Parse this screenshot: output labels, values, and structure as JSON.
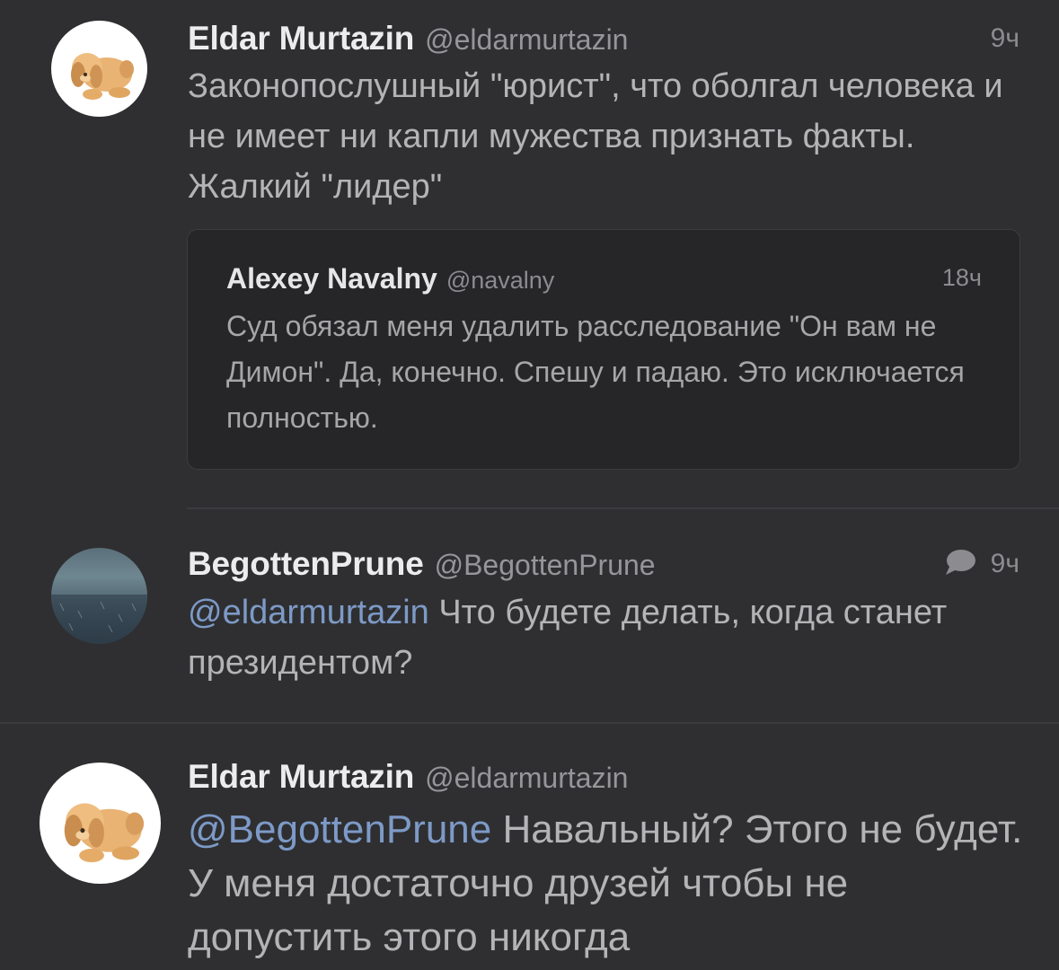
{
  "tweets": [
    {
      "name": "Eldar Murtazin",
      "handle": "@eldarmurtazin",
      "time": "9ч",
      "text": "Законопослушный \"юрист\", что оболгал человека и не имеет ни капли мужества признать факты. Жалкий \"лидер\"",
      "avatar_icon": "plush-dog-avatar",
      "quote": {
        "name": "Alexey Navalny",
        "handle": "@navalny",
        "time": "18ч",
        "text": "Суд обязал меня удалить расследование \"Он вам не Димон\". Да, конечно. Спешу и падаю. Это исключается полностью."
      }
    },
    {
      "name": "BegottenPrune",
      "handle": "@BegottenPrune",
      "time": "9ч",
      "reply_icon": "speech-bubble-icon",
      "mention": "@eldarmurtazin",
      "text": " Что будете делать, когда станет президентом?",
      "avatar_icon": "rainy-landscape-avatar"
    },
    {
      "name": "Eldar Murtazin",
      "handle": "@eldarmurtazin",
      "mention": "@BegottenPrune",
      "text": " Навальный? Этого не будет. У меня достаточно друзей чтобы не допустить этого никогда",
      "avatar_icon": "plush-dog-avatar"
    }
  ],
  "colors": {
    "background": "#2f2f31",
    "quote_background": "#262628",
    "mention": "#7d9ac7",
    "name": "#ececee"
  }
}
